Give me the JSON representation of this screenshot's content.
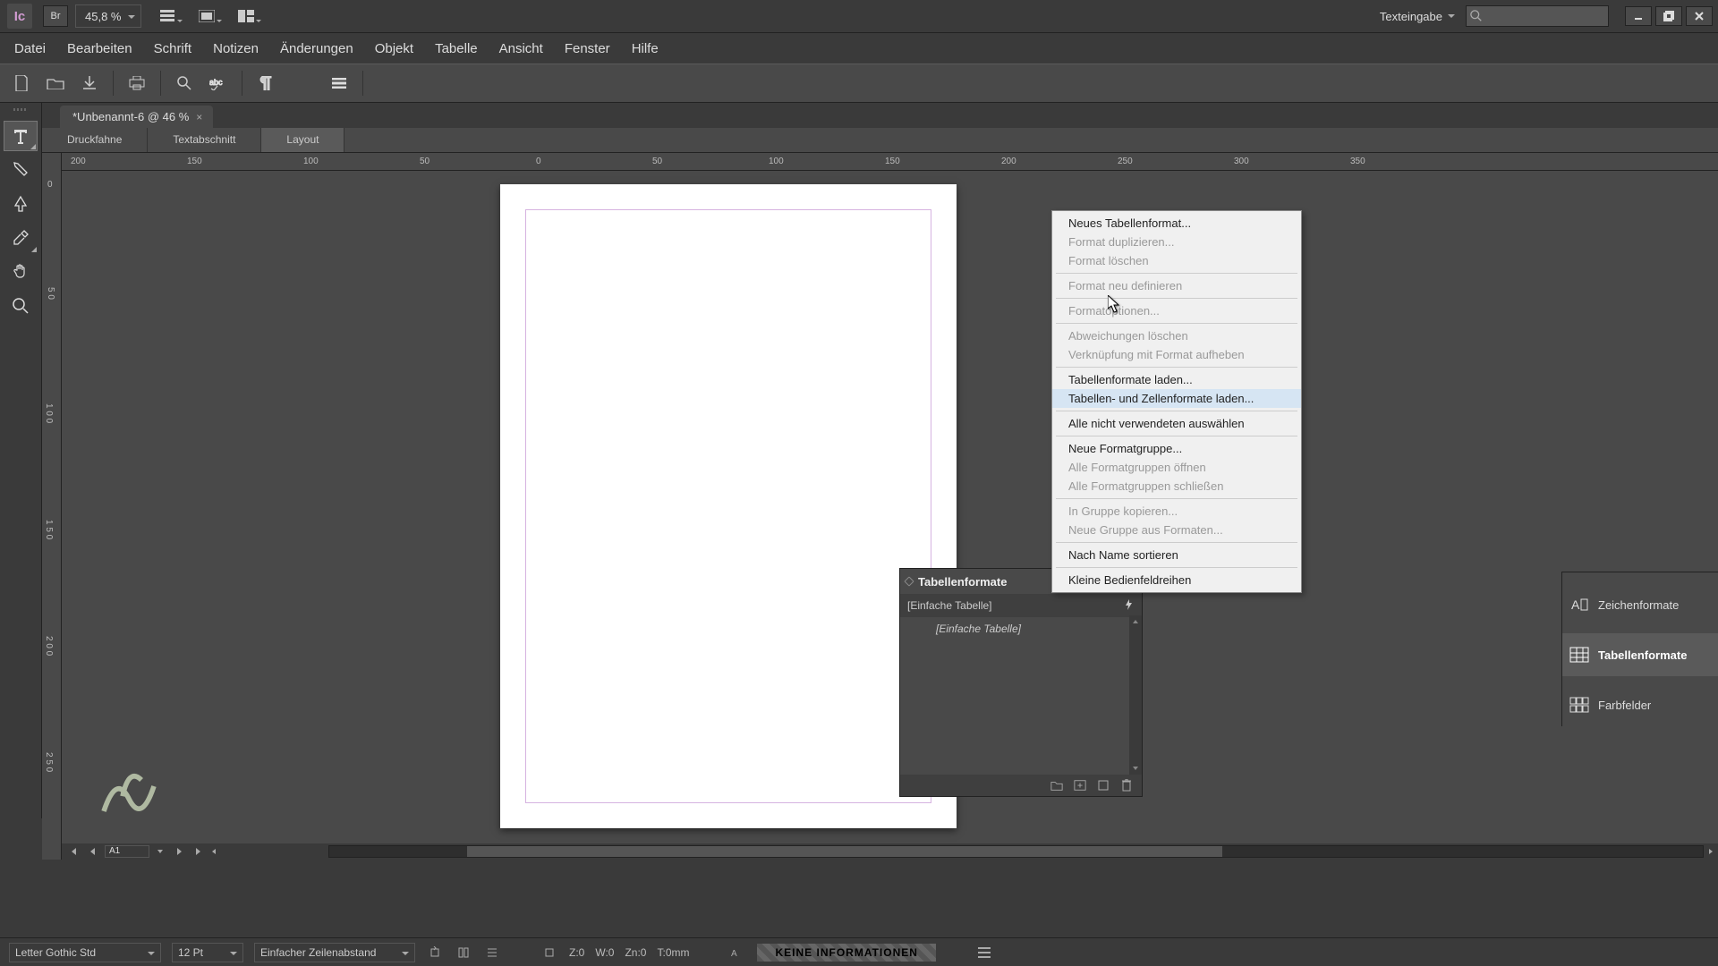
{
  "app": {
    "logo": "Ic",
    "br": "Br",
    "zoom": "45,8 %"
  },
  "workspace": "Texteingabe",
  "menu": [
    "Datei",
    "Bearbeiten",
    "Schrift",
    "Notizen",
    "Änderungen",
    "Objekt",
    "Tabelle",
    "Ansicht",
    "Fenster",
    "Hilfe"
  ],
  "doc_tab": "*Unbenannt-6 @ 46 %",
  "view_tabs": [
    "Druckfahne",
    "Textabschnitt",
    "Layout"
  ],
  "page_field": "A1",
  "hruler_marks": [
    "200",
    "150",
    "100",
    "50",
    "0",
    "50",
    "100",
    "150",
    "200",
    "250",
    "300",
    "350"
  ],
  "vruler_marks": [
    "0",
    "5 0",
    "1 0 0",
    "1 5 0",
    "2 0 0",
    "2 5 0"
  ],
  "panel": {
    "title": "Tabellenformate",
    "head_item": "[Einfache Tabelle]",
    "list_item": "[Einfache Tabelle]"
  },
  "dock": {
    "char": "Zeichenformate",
    "table": "Tabellenformate",
    "swatch": "Farbfelder"
  },
  "context_menu": [
    {
      "t": "Neues Tabellenformat...",
      "d": false
    },
    {
      "t": "Format duplizieren...",
      "d": true
    },
    {
      "t": "Format löschen",
      "d": true
    },
    {
      "sep": true
    },
    {
      "t": "Format neu definieren",
      "d": true
    },
    {
      "sep": true
    },
    {
      "t": "Formatoptionen...",
      "d": true
    },
    {
      "sep": true
    },
    {
      "t": "Abweichungen löschen",
      "d": true
    },
    {
      "t": "Verknüpfung mit Format aufheben",
      "d": true
    },
    {
      "sep": true
    },
    {
      "t": "Tabellenformate laden...",
      "d": false
    },
    {
      "t": "Tabellen- und Zellenformate laden...",
      "d": false,
      "hl": true
    },
    {
      "sep": true
    },
    {
      "t": "Alle nicht verwendeten auswählen",
      "d": false
    },
    {
      "sep": true
    },
    {
      "t": "Neue Formatgruppe...",
      "d": false
    },
    {
      "t": "Alle Formatgruppen öffnen",
      "d": true
    },
    {
      "t": "Alle Formatgruppen schließen",
      "d": true
    },
    {
      "sep": true
    },
    {
      "t": "In Gruppe kopieren...",
      "d": true
    },
    {
      "t": "Neue Gruppe aus Formaten...",
      "d": true
    },
    {
      "sep": true
    },
    {
      "t": "Nach Name sortieren",
      "d": false
    },
    {
      "sep": true
    },
    {
      "t": "Kleine Bedienfeldreihen",
      "d": false
    }
  ],
  "status": {
    "font": "Letter Gothic Std",
    "size": "12 Pt",
    "leading": "Einfacher Zeilenabstand",
    "z": "Z:0",
    "w": "W:0",
    "zn": "Zn:0",
    "t": "T:0mm",
    "noinfo": "KEINE INFORMATIONEN"
  }
}
